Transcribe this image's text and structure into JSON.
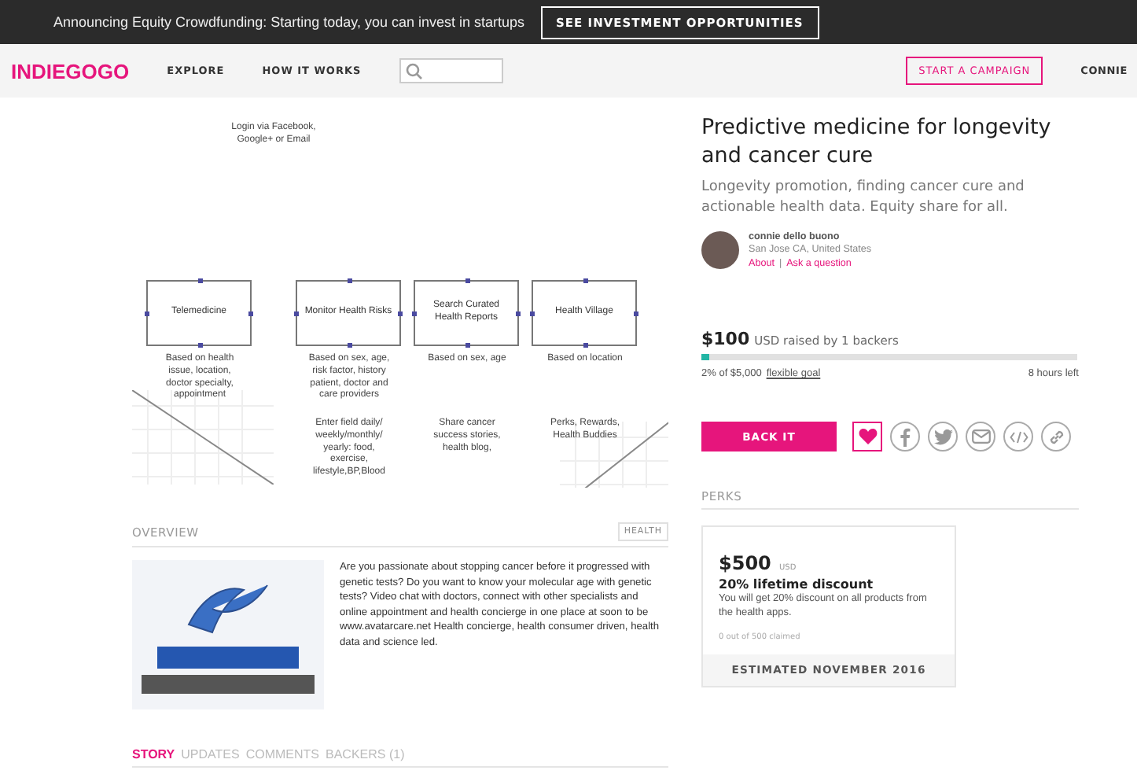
{
  "announcement": {
    "text": "Announcing Equity Crowdfunding: Starting today, you can invest in startups",
    "button": "SEE INVESTMENT OPPORTUNITIES"
  },
  "nav": {
    "logo": "INDIEGOGO",
    "links": [
      "EXPLORE",
      "HOW IT WORKS"
    ],
    "cta": "START A CAMPAIGN",
    "user": "CONNIE"
  },
  "diagram": {
    "login_note": "Login via Facebook, Google+ or Email",
    "nodes": [
      {
        "label": "Telemedicine",
        "note": "Based on health issue, location, doctor specialty, appointment"
      },
      {
        "label": "Monitor Health Risks",
        "note": "Based on sex, age, risk factor, history patient, doctor and care providers",
        "extra_note": "Enter field daily/ weekly/monthly/ yearly: food, exercise, lifestyle,BP,Blood"
      },
      {
        "label": "Search Curated Health Reports",
        "note": "Based on sex, age",
        "extra_note": "Share cancer success stories, health blog,"
      },
      {
        "label": "Health Village",
        "note": "Based on location",
        "extra_note": "Perks, Rewards, Health Buddies"
      }
    ]
  },
  "campaign": {
    "title": "Predictive medicine for longevity and cancer cure",
    "tagline": "Longevity promotion, finding cancer cure and actionable health data. Equity share for all.",
    "owner": {
      "name": "connie dello buono",
      "location": "San Jose CA, United States",
      "links": [
        "About",
        "Ask a question"
      ],
      "separator": "|"
    },
    "raised": "$100",
    "raised_note": "USD raised by 1 backers",
    "level": 0.02,
    "goal_text": "2% of $5,000",
    "goal_link": "flexible goal",
    "time_left": "8 hours left",
    "back_button": "BACK IT"
  },
  "overview": {
    "heading": "OVERVIEW",
    "tag": "HEALTH",
    "text": "Are you passionate about stopping cancer before it progressed with genetic tests? Do you want to know your molecular age with genetic tests? Video chat with doctors, connect with other specialists and online appointment and health concierge in one place at soon to be www.avatarcare.net Health concierge, health consumer driven, health data and science led."
  },
  "tabs": [
    {
      "label": "STORY",
      "selected": true
    },
    {
      "label": "UPDATES",
      "selected": false
    },
    {
      "label": "COMMENTS",
      "selected": false
    },
    {
      "label": "BACKERS (1)",
      "selected": false
    }
  ],
  "perks": {
    "heading": "PERKS",
    "items": [
      {
        "price": "$500",
        "currency": "USD",
        "title": "20% lifetime discount",
        "description": "You will get 20% discount on all products from the health apps.",
        "claimed": "0 out of 500 claimed",
        "estimated": "ESTIMATED NOVEMBER 2016"
      }
    ]
  }
}
